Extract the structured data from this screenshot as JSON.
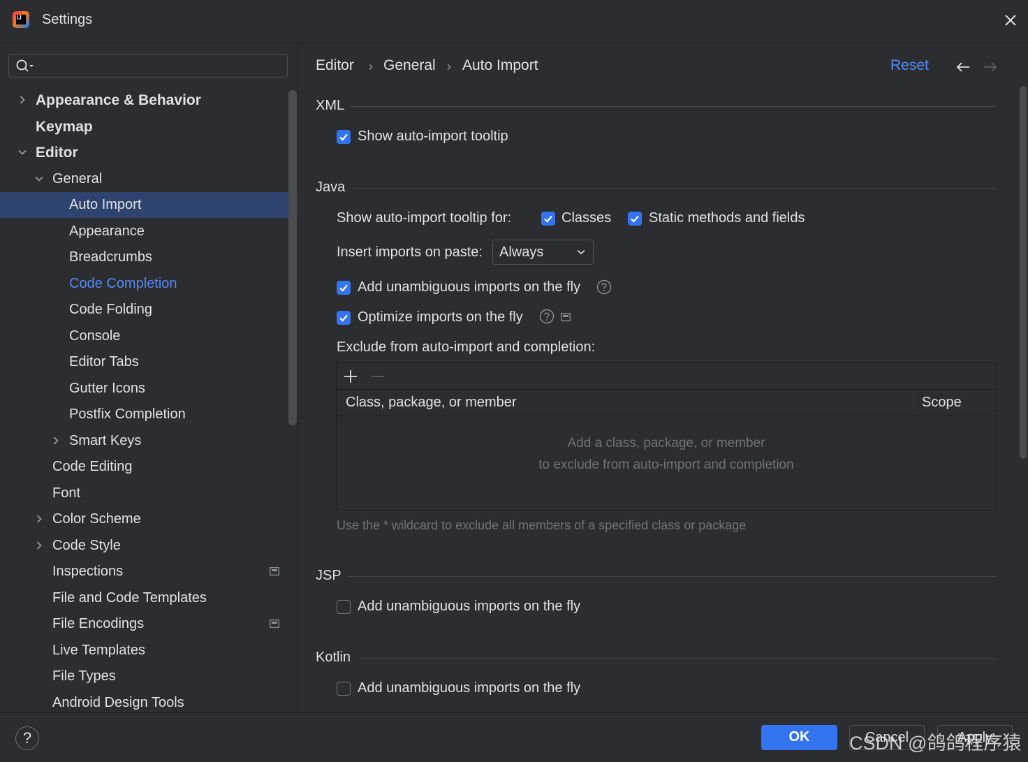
{
  "window": {
    "title": "Settings"
  },
  "search": {
    "placeholder": ""
  },
  "tree": [
    {
      "label": "Appearance & Behavior",
      "indent": 0,
      "chevron": "right",
      "bold": true
    },
    {
      "label": "Keymap",
      "indent": 0,
      "chevron": "none",
      "bold": true
    },
    {
      "label": "Editor",
      "indent": 0,
      "chevron": "down",
      "bold": true
    },
    {
      "label": "General",
      "indent": 1,
      "chevron": "down"
    },
    {
      "label": "Auto Import",
      "indent": 2,
      "chevron": "none",
      "selected": true
    },
    {
      "label": "Appearance",
      "indent": 2,
      "chevron": "none"
    },
    {
      "label": "Breadcrumbs",
      "indent": 2,
      "chevron": "none"
    },
    {
      "label": "Code Completion",
      "indent": 2,
      "chevron": "none",
      "link": true
    },
    {
      "label": "Code Folding",
      "indent": 2,
      "chevron": "none"
    },
    {
      "label": "Console",
      "indent": 2,
      "chevron": "none"
    },
    {
      "label": "Editor Tabs",
      "indent": 2,
      "chevron": "none"
    },
    {
      "label": "Gutter Icons",
      "indent": 2,
      "chevron": "none"
    },
    {
      "label": "Postfix Completion",
      "indent": 2,
      "chevron": "none"
    },
    {
      "label": "Smart Keys",
      "indent": 2,
      "chevron": "right"
    },
    {
      "label": "Code Editing",
      "indent": 1,
      "chevron": "none"
    },
    {
      "label": "Font",
      "indent": 1,
      "chevron": "none"
    },
    {
      "label": "Color Scheme",
      "indent": 1,
      "chevron": "right"
    },
    {
      "label": "Code Style",
      "indent": 1,
      "chevron": "right"
    },
    {
      "label": "Inspections",
      "indent": 1,
      "chevron": "none",
      "project_icon": true
    },
    {
      "label": "File and Code Templates",
      "indent": 1,
      "chevron": "none"
    },
    {
      "label": "File Encodings",
      "indent": 1,
      "chevron": "none",
      "project_icon": true
    },
    {
      "label": "Live Templates",
      "indent": 1,
      "chevron": "none"
    },
    {
      "label": "File Types",
      "indent": 1,
      "chevron": "none"
    },
    {
      "label": "Android Design Tools",
      "indent": 1,
      "chevron": "none"
    }
  ],
  "breadcrumb": {
    "items": [
      "Editor",
      "General",
      "Auto Import"
    ],
    "separator": "›"
  },
  "header": {
    "reset": "Reset"
  },
  "xml": {
    "title": "XML",
    "show_tooltip": {
      "label": "Show auto-import tooltip",
      "checked": true
    }
  },
  "java": {
    "title": "Java",
    "tooltip_for_label": "Show auto-import tooltip for:",
    "classes": {
      "label": "Classes",
      "checked": true
    },
    "static_members": {
      "label": "Static methods and fields",
      "checked": true
    },
    "insert_on_paste_label": "Insert imports on paste:",
    "insert_on_paste_value": "Always",
    "add_unambiguous": {
      "label": "Add unambiguous imports on the fly",
      "checked": true
    },
    "optimize": {
      "label": "Optimize imports on the fly",
      "checked": true
    },
    "exclude_label": "Exclude from auto-import and completion:",
    "table": {
      "columns": [
        "Class, package, or member",
        "Scope"
      ],
      "empty_line1": "Add a class, package, or member",
      "empty_line2": "to exclude from auto-import and completion"
    },
    "hint": "Use the * wildcard to exclude all members of a specified class or package"
  },
  "jsp": {
    "title": "JSP",
    "add_unambiguous": {
      "label": "Add unambiguous imports on the fly",
      "checked": false
    }
  },
  "kotlin": {
    "title": "Kotlin",
    "add_unambiguous": {
      "label": "Add unambiguous imports on the fly",
      "checked": false
    }
  },
  "footer": {
    "help": "?",
    "ok": "OK",
    "cancel": "Cancel",
    "apply": "Apply"
  },
  "watermark": "CSDN @鸽鸽程序猿",
  "colors": {
    "accent": "#3574f0",
    "link": "#548af7",
    "selected_row": "#2e436e",
    "background": "#2b2d30"
  }
}
